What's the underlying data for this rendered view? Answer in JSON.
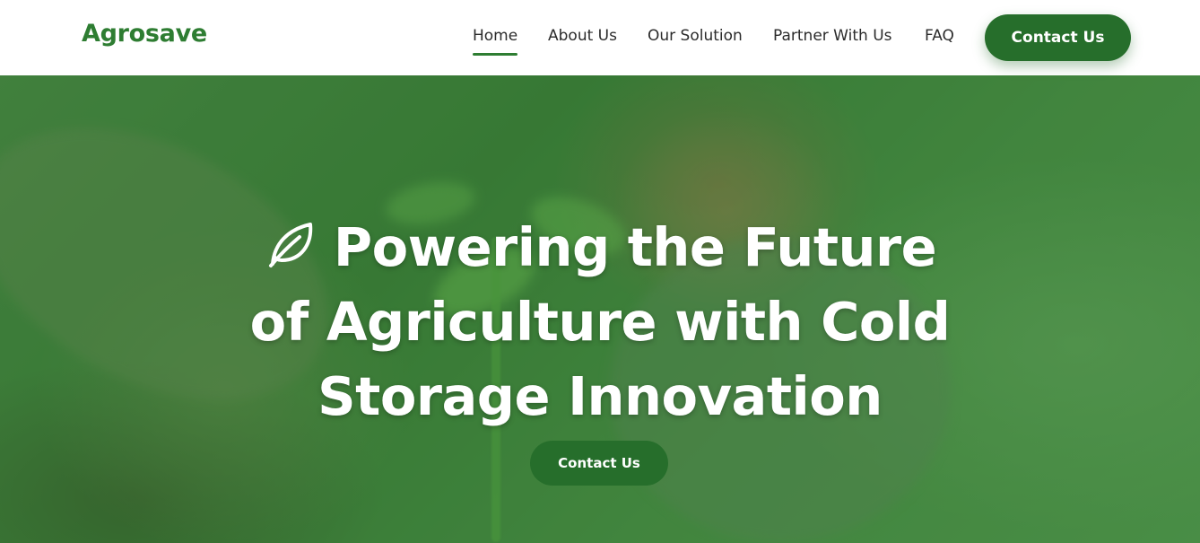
{
  "brand": {
    "logo": "Agrosave",
    "accent_color": "#2e7d32"
  },
  "nav": {
    "items": [
      {
        "label": "Home",
        "active": true
      },
      {
        "label": "About Us",
        "active": false
      },
      {
        "label": "Our Solution",
        "active": false
      },
      {
        "label": "Partner With Us",
        "active": false
      },
      {
        "label": "FAQ",
        "active": false
      }
    ],
    "cta_label": "Contact Us"
  },
  "hero": {
    "icon": "leaf-icon",
    "title": "Powering the Future of Agriculture with Cold Storage Innovation",
    "cta_label": "Contact Us",
    "overlay_color": "#2e7d32"
  }
}
